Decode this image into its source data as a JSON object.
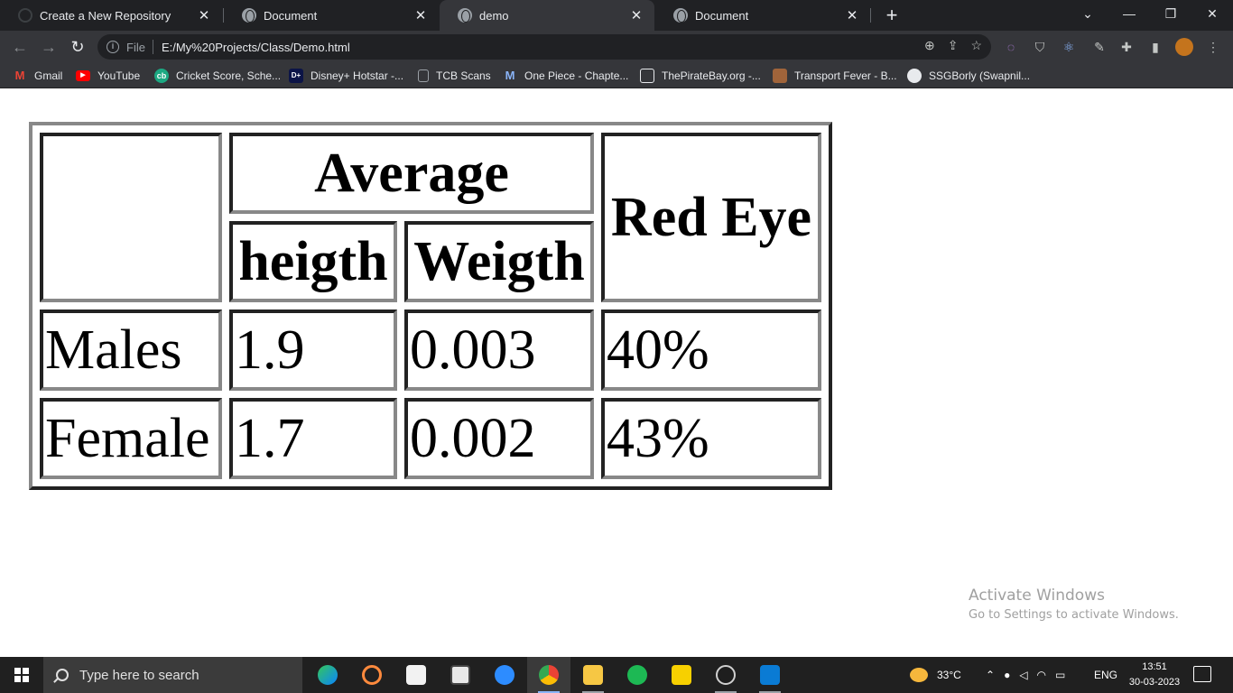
{
  "browser": {
    "tabs": [
      {
        "title": "Create a New Repository",
        "active": false,
        "favicon": "github-icon"
      },
      {
        "title": "Document",
        "active": false,
        "favicon": "globe-icon"
      },
      {
        "title": "demo",
        "active": true,
        "favicon": "globe-icon"
      },
      {
        "title": "Document",
        "active": false,
        "favicon": "globe-icon"
      }
    ],
    "address": {
      "scheme_label": "File",
      "url": "E:/My%20Projects/Class/Demo.html"
    },
    "bookmarks": [
      {
        "label": "Gmail",
        "icon": "gmail-icon"
      },
      {
        "label": "YouTube",
        "icon": "youtube-icon"
      },
      {
        "label": "Cricket Score, Sche...",
        "icon": "cricbuzz-icon"
      },
      {
        "label": "Disney+ Hotstar -...",
        "icon": "hotstar-icon"
      },
      {
        "label": "TCB Scans",
        "icon": "page-icon"
      },
      {
        "label": "One Piece - Chapte...",
        "icon": "manga-icon"
      },
      {
        "label": "ThePirateBay.org -...",
        "icon": "piratebay-icon"
      },
      {
        "label": "Transport Fever - B...",
        "icon": "game-icon"
      },
      {
        "label": "SSGBorly (Swapnil...",
        "icon": "github-icon"
      }
    ],
    "colors": {
      "frame": "#202124",
      "toolbar": "#35363a",
      "text": "#e8eaed"
    }
  },
  "page": {
    "table": {
      "header": {
        "group_label": "Average",
        "sub_labels": [
          "heigth",
          "Weigth"
        ],
        "last_label": "Red Eye"
      },
      "rows": [
        {
          "label": "Males",
          "height": "1.9",
          "weight": "0.003",
          "red_eye": "40%"
        },
        {
          "label": "Female",
          "height": "1.7",
          "weight": "0.002",
          "red_eye": "43%"
        }
      ]
    }
  },
  "watermark": {
    "line1": "Activate Windows",
    "line2": "Go to Settings to activate Windows."
  },
  "taskbar": {
    "search_placeholder": "Type here to search",
    "apps": [
      "edge-icon",
      "media-player-icon",
      "solitaire-icon",
      "office-icon",
      "zoom-icon",
      "chrome-icon",
      "file-explorer-icon",
      "spotify-icon",
      "sticky-notes-icon",
      "obs-icon",
      "vscode-icon"
    ],
    "weather": "33°C",
    "language": "ENG",
    "time": "13:51",
    "date": "30-03-2023"
  }
}
